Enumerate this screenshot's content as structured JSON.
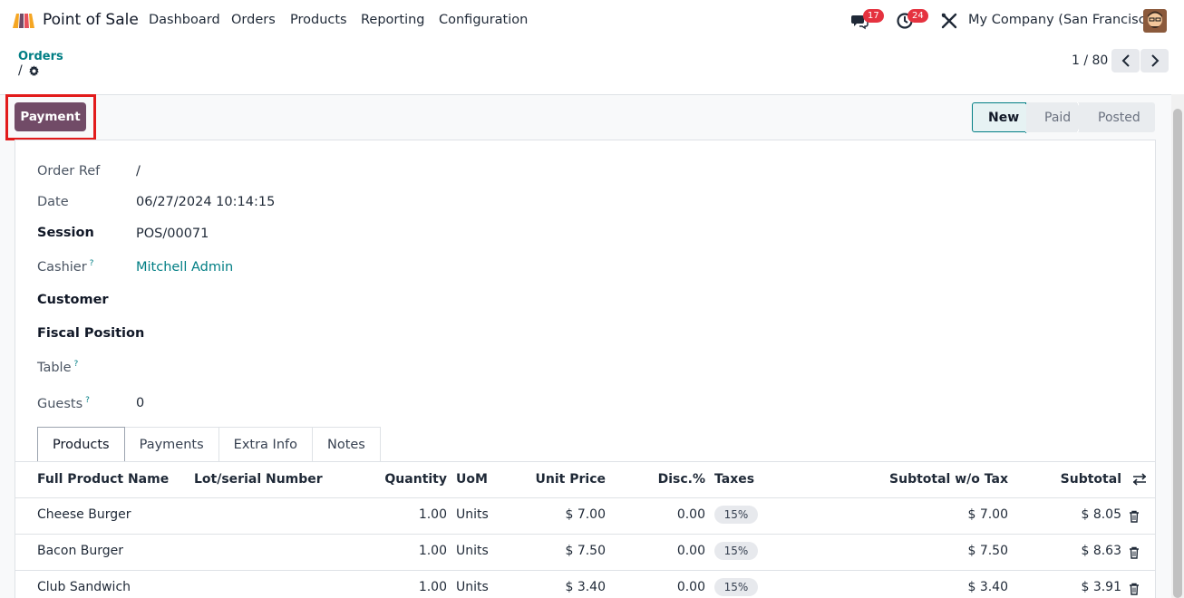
{
  "app": {
    "title": "Point of Sale",
    "menu": [
      "Dashboard",
      "Orders",
      "Products",
      "Reporting",
      "Configuration"
    ],
    "messages_count": "17",
    "activities_count": "24",
    "company": "My Company (San Francisco)",
    "icons": {
      "logo": "pos-logo-icon",
      "messages": "chat-icon",
      "activities": "clock-icon",
      "debug": "tools-icon",
      "avatar": "user-avatar"
    }
  },
  "control_panel": {
    "breadcrumb_parent": "Orders",
    "breadcrumb_current": "/",
    "pager": "1 / 80"
  },
  "form": {
    "payment_button": "Payment",
    "status_steps": [
      "New",
      "Paid",
      "Posted"
    ],
    "status_current": "New",
    "fields": {
      "order_ref": {
        "label": "Order Ref",
        "value": "/"
      },
      "date": {
        "label": "Date",
        "value": "06/27/2024 10:14:15"
      },
      "session": {
        "label": "Session",
        "value": "POS/00071"
      },
      "cashier": {
        "label": "Cashier",
        "help": "?",
        "value": "Mitchell Admin"
      },
      "customer": {
        "label": "Customer",
        "value": ""
      },
      "fiscal_position": {
        "label": "Fiscal Position",
        "value": ""
      },
      "table": {
        "label": "Table",
        "help": "?",
        "value": ""
      },
      "guests": {
        "label": "Guests",
        "help": "?",
        "value": "0"
      }
    },
    "tabs": [
      "Products",
      "Payments",
      "Extra Info",
      "Notes"
    ],
    "active_tab": "Products"
  },
  "order_lines": {
    "columns": [
      "Full Product Name",
      "Lot/serial Number",
      "Quantity",
      "UoM",
      "Unit Price",
      "Disc.%",
      "Taxes",
      "Subtotal w/o Tax",
      "Subtotal"
    ],
    "rows": [
      {
        "name": "Cheese Burger",
        "lot": "",
        "qty": "1.00",
        "uom": "Units",
        "price": "$ 7.00",
        "disc": "0.00",
        "tax": "15%",
        "subtotal_wo_tax": "$ 7.00",
        "subtotal": "$ 8.05"
      },
      {
        "name": "Bacon Burger",
        "lot": "",
        "qty": "1.00",
        "uom": "Units",
        "price": "$ 7.50",
        "disc": "0.00",
        "tax": "15%",
        "subtotal_wo_tax": "$ 7.50",
        "subtotal": "$ 8.63"
      },
      {
        "name": "Club Sandwich",
        "lot": "",
        "qty": "1.00",
        "uom": "Units",
        "price": "$ 3.40",
        "disc": "0.00",
        "tax": "15%",
        "subtotal_wo_tax": "$ 3.40",
        "subtotal": "$ 3.91"
      }
    ]
  },
  "colors": {
    "brand": "#714b67",
    "link": "#017e84",
    "badge": "#e5323f",
    "highlight": "#e21b1b"
  }
}
